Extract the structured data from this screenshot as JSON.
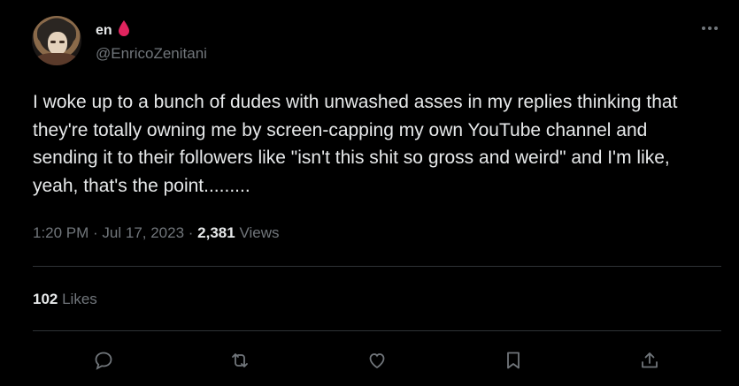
{
  "author": {
    "display_name": "en",
    "handle": "@EnricoZenitani",
    "emoji_icon": "blood-drop-icon"
  },
  "tweet": {
    "text": "I woke up to a bunch of dudes with unwashed asses in my replies thinking that they're totally owning me by screen-capping my own YouTube channel and sending it to their followers like \"isn't this shit so gross and weird\" and I'm like, yeah, that's the point.........",
    "time": "1:20 PM",
    "sep1": " · ",
    "date": "Jul 17, 2023",
    "sep2": " · ",
    "views_count": "2,381",
    "views_label": " Views"
  },
  "stats": {
    "likes_count": "102",
    "likes_label": " Likes"
  },
  "actions": [
    "reply-icon",
    "retweet-icon",
    "like-icon",
    "bookmark-icon",
    "share-icon"
  ],
  "colors": {
    "background": "#000000",
    "text": "#e7e9ea",
    "muted": "#71767b",
    "divider": "#2f3336",
    "emoji_red": "#e0245e"
  }
}
